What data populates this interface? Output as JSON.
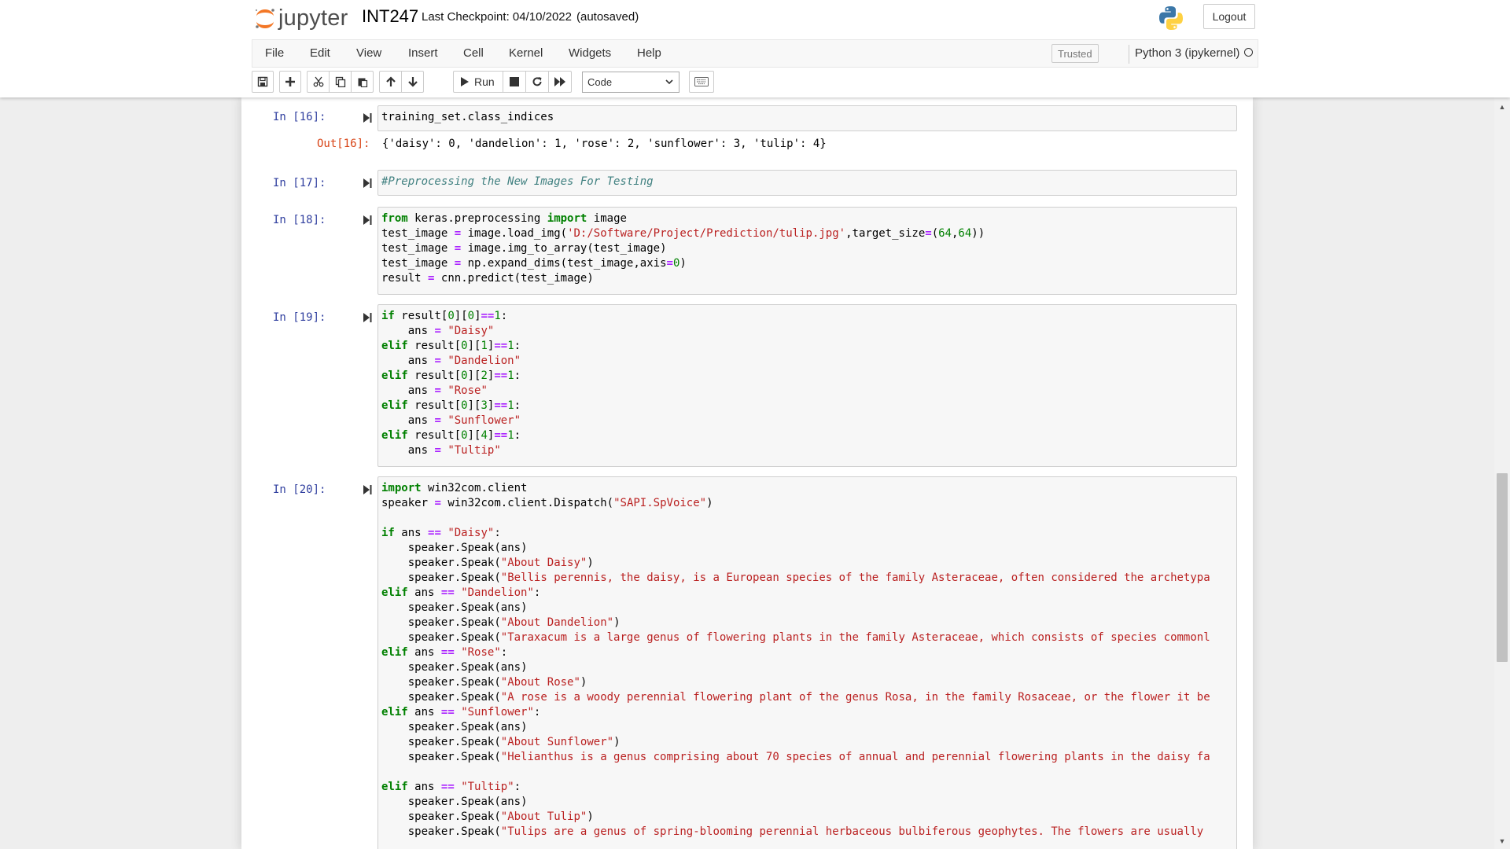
{
  "header": {
    "logo_text": "jupyter",
    "notebook_name": "INT247",
    "checkpoint": "Last Checkpoint: 04/10/2022",
    "autosave": "(autosaved)",
    "logout_label": "Logout"
  },
  "menu": {
    "items": [
      "File",
      "Edit",
      "View",
      "Insert",
      "Cell",
      "Kernel",
      "Widgets",
      "Help"
    ],
    "trusted": "Trusted",
    "kernel_name": "Python 3 (ipykernel)"
  },
  "toolbar": {
    "run_label": "Run",
    "cell_type": "Code",
    "icons": [
      "save-icon",
      "plus-icon",
      "cut-icon",
      "copy-icon",
      "paste-icon",
      "arrow-up-icon",
      "arrow-down-icon",
      "run-icon",
      "stop-icon",
      "restart-icon",
      "fast-forward-icon",
      "keyboard-icon"
    ]
  },
  "cells": [
    {
      "prompt": "In [16]:",
      "code": [
        "training_set.class_indices"
      ],
      "output_prompt": "Out[16]:",
      "output": "{'daisy': 0, 'dandelion': 1, 'rose': 2, 'sunflower': 3, 'tulip': 4}"
    },
    {
      "prompt": "In [17]:",
      "code": [
        "#Preprocessing the New Images For Testing"
      ]
    },
    {
      "prompt": "In [18]:",
      "code": [
        "from keras.preprocessing import image",
        "test_image = image.load_img('D:/Software/Project/Prediction/tulip.jpg',target_size=(64,64))",
        "test_image = image.img_to_array(test_image)",
        "test_image = np.expand_dims(test_image,axis=0)",
        "result = cnn.predict(test_image)"
      ]
    },
    {
      "prompt": "In [19]:",
      "code": [
        "if result[0][0]==1:",
        "    ans = \"Daisy\"",
        "elif result[0][1]==1:",
        "    ans = \"Dandelion\"",
        "elif result[0][2]==1:",
        "    ans = \"Rose\"",
        "elif result[0][3]==1:",
        "    ans = \"Sunflower\"",
        "elif result[0][4]==1:",
        "    ans = \"Tultip\""
      ]
    },
    {
      "prompt": "In [20]:",
      "code": [
        "import win32com.client",
        "speaker = win32com.client.Dispatch(\"SAPI.SpVoice\")",
        "",
        "if ans == \"Daisy\":",
        "    speaker.Speak(ans)",
        "    speaker.Speak(\"About Daisy\")",
        "    speaker.Speak(\"Bellis perennis, the daisy, is a European species of the family Asteraceae, often considered the archetypa",
        "elif ans == \"Dandelion\":",
        "    speaker.Speak(ans)",
        "    speaker.Speak(\"About Dandelion\")",
        "    speaker.Speak(\"Taraxacum is a large genus of flowering plants in the family Asteraceae, which consists of species commonl",
        "elif ans == \"Rose\":",
        "    speaker.Speak(ans)",
        "    speaker.Speak(\"About Rose\")",
        "    speaker.Speak(\"A rose is a woody perennial flowering plant of the genus Rosa, in the family Rosaceae, or the flower it be",
        "elif ans == \"Sunflower\":",
        "    speaker.Speak(ans)",
        "    speaker.Speak(\"About Sunflower\")",
        "    speaker.Speak(\"Helianthus is a genus comprising about 70 species of annual and perennial flowering plants in the daisy fa",
        "",
        "elif ans == \"Tultip\":",
        "    speaker.Speak(ans)",
        "    speaker.Speak(\"About Tulip\")",
        "    speaker.Speak(\"Tulips are a genus of spring-blooming perennial herbaceous bulbiferous geophytes. The flowers are usually "
      ]
    }
  ]
}
